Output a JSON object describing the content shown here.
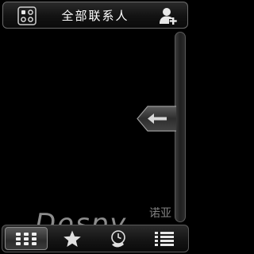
{
  "header": {
    "title": "全部联系人",
    "left_icon": "dialpad-grid-icon",
    "right_icon": "add-contact-icon"
  },
  "side": {
    "pull_tab_icon": "arrow-left-icon"
  },
  "tabbar": {
    "tabs": [
      {
        "icon": "keypad-grid-icon",
        "active": true
      },
      {
        "icon": "star-favorites-icon",
        "active": false
      },
      {
        "icon": "call-log-icon",
        "active": false
      },
      {
        "icon": "list-menu-icon",
        "active": false
      }
    ]
  },
  "watermark": {
    "text": "Dospy",
    "cn": "诺亚"
  },
  "colors": {
    "background": "#000000",
    "bar_border": "#6b6b6b",
    "text": "#ffffff"
  }
}
